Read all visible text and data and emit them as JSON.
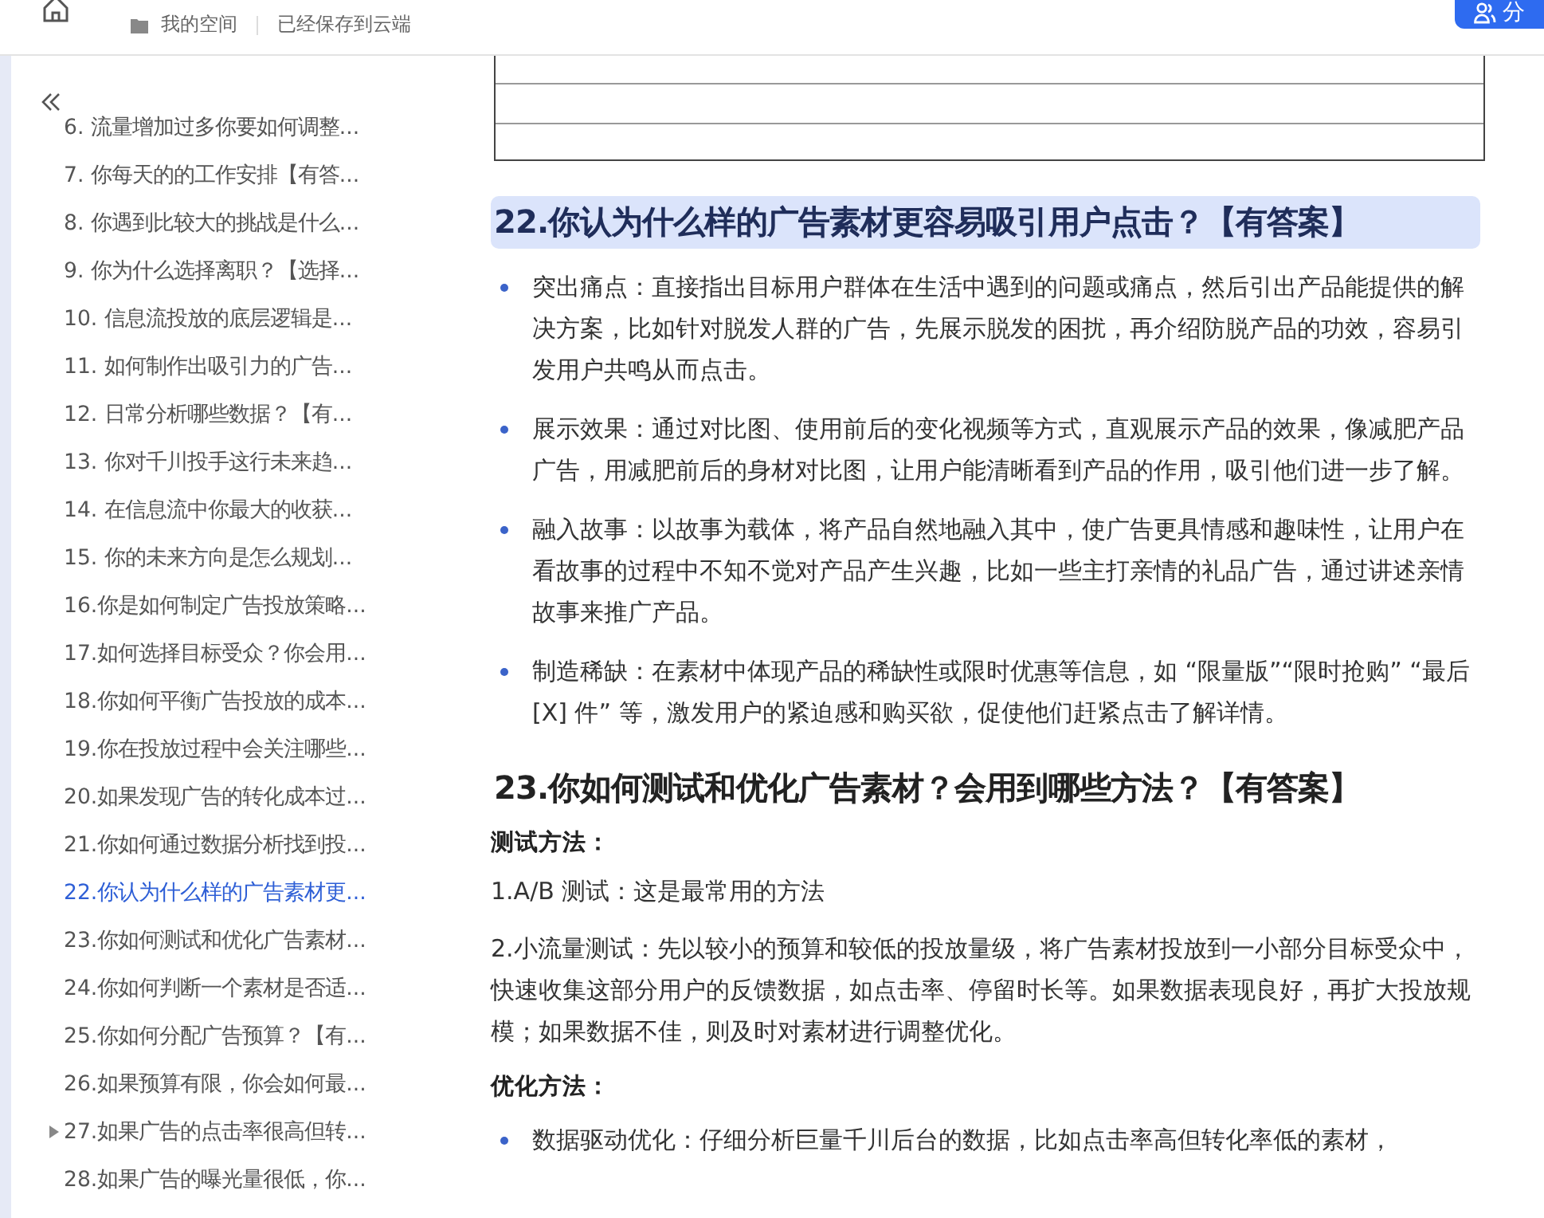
{
  "header": {
    "space": "我的空间",
    "save_status": "已经保存到云端",
    "share_button": "分"
  },
  "sidebar": {
    "items": [
      {
        "label": "6. 流量增加过多你要如何调整...",
        "selected": false,
        "expandable": false
      },
      {
        "label": "7. 你每天的的工作安排【有答...",
        "selected": false,
        "expandable": false
      },
      {
        "label": "8. 你遇到比较大的挑战是什么...",
        "selected": false,
        "expandable": false
      },
      {
        "label": "9. 你为什么选择离职？【选择...",
        "selected": false,
        "expandable": false
      },
      {
        "label": "10. 信息流投放的底层逻辑是...",
        "selected": false,
        "expandable": false
      },
      {
        "label": "11. 如何制作出吸引力的广告...",
        "selected": false,
        "expandable": false
      },
      {
        "label": "12. 日常分析哪些数据？【有...",
        "selected": false,
        "expandable": false
      },
      {
        "label": "13. 你对千川投手这行未来趋...",
        "selected": false,
        "expandable": false
      },
      {
        "label": "14. 在信息流中你最大的收获...",
        "selected": false,
        "expandable": false
      },
      {
        "label": "15. 你的未来方向是怎么规划...",
        "selected": false,
        "expandable": false
      },
      {
        "label": "16.你是如何制定广告投放策略...",
        "selected": false,
        "expandable": false
      },
      {
        "label": "17.如何选择目标受众？你会用...",
        "selected": false,
        "expandable": false
      },
      {
        "label": "18.你如何平衡广告投放的成本...",
        "selected": false,
        "expandable": false
      },
      {
        "label": "19.你在投放过程中会关注哪些...",
        "selected": false,
        "expandable": false
      },
      {
        "label": "20.如果发现广告的转化成本过...",
        "selected": false,
        "expandable": false
      },
      {
        "label": "21.你如何通过数据分析找到投...",
        "selected": false,
        "expandable": false
      },
      {
        "label": "22.你认为什么样的广告素材更...",
        "selected": true,
        "expandable": false
      },
      {
        "label": "23.你如何测试和优化广告素材...",
        "selected": false,
        "expandable": false
      },
      {
        "label": "24.你如何判断一个素材是否适...",
        "selected": false,
        "expandable": false
      },
      {
        "label": "25.你如何分配广告预算？【有...",
        "selected": false,
        "expandable": false
      },
      {
        "label": "26.如果预算有限，你会如何最...",
        "selected": false,
        "expandable": false
      },
      {
        "label": "27.如果广告的点击率很高但转...",
        "selected": false,
        "expandable": true
      },
      {
        "label": "28.如果广告的曝光量很低，你...",
        "selected": false,
        "expandable": false
      }
    ]
  },
  "content": [
    {
      "kind": "image"
    },
    {
      "kind": "heading",
      "text": "22.你认为什么样的广告素材更容易吸引用户点击？【有答案】",
      "highlighted": true
    },
    {
      "kind": "bullet",
      "text": "突出痛点：直接指出目标用户群体在生活中遇到的问题或痛点，然后引出产品能提供的解决方案，比如针对脱发人群的广告，先展示脱发的困扰，再介绍防脱产品的功效，容易引发用户共鸣从而点击。"
    },
    {
      "kind": "bullet",
      "text": "展示效果：通过对比图、使用前后的变化视频等方式，直观展示产品的效果，像减肥产品广告，用减肥前后的身材对比图，让用户能清晰看到产品的作用，吸引他们进一步了解。"
    },
    {
      "kind": "bullet",
      "text": "融入故事：以故事为载体，将产品自然地融入其中，使广告更具情感和趣味性，让用户在看故事的过程中不知不觉对产品产生兴趣，比如一些主打亲情的礼品广告，通过讲述亲情故事来推广产品。"
    },
    {
      "kind": "bullet",
      "text": "制造稀缺：在素材中体现产品的稀缺性或限时优惠等信息，如 “限量版”“限时抢购” “最后 [X] 件” 等，激发用户的紧迫感和购买欲，促使他们赶紧点击了解详情。"
    },
    {
      "kind": "heading",
      "text": "23.你如何测试和优化广告素材？会用到哪些方法？【有答案】",
      "highlighted": false
    },
    {
      "kind": "subheading",
      "text": "测试方法："
    },
    {
      "kind": "paragraph",
      "text": "1.A/B 测试：这是最常用的方法"
    },
    {
      "kind": "paragraph",
      "text": "2.小流量测试：先以较小的预算和较低的投放量级，将广告素材投放到一小部分目标受众中，快速收集这部分用户的反馈数据，如点击率、停留时长等。如果数据表现良好，再扩大投放规模；如果数据不佳，则及时对素材进行调整优化。"
    },
    {
      "kind": "subheading",
      "text": "优化方法："
    },
    {
      "kind": "bullet",
      "text": "数据驱动优化：仔细分析巨量千川后台的数据，比如点击率高但转化率低的素材，"
    }
  ]
}
